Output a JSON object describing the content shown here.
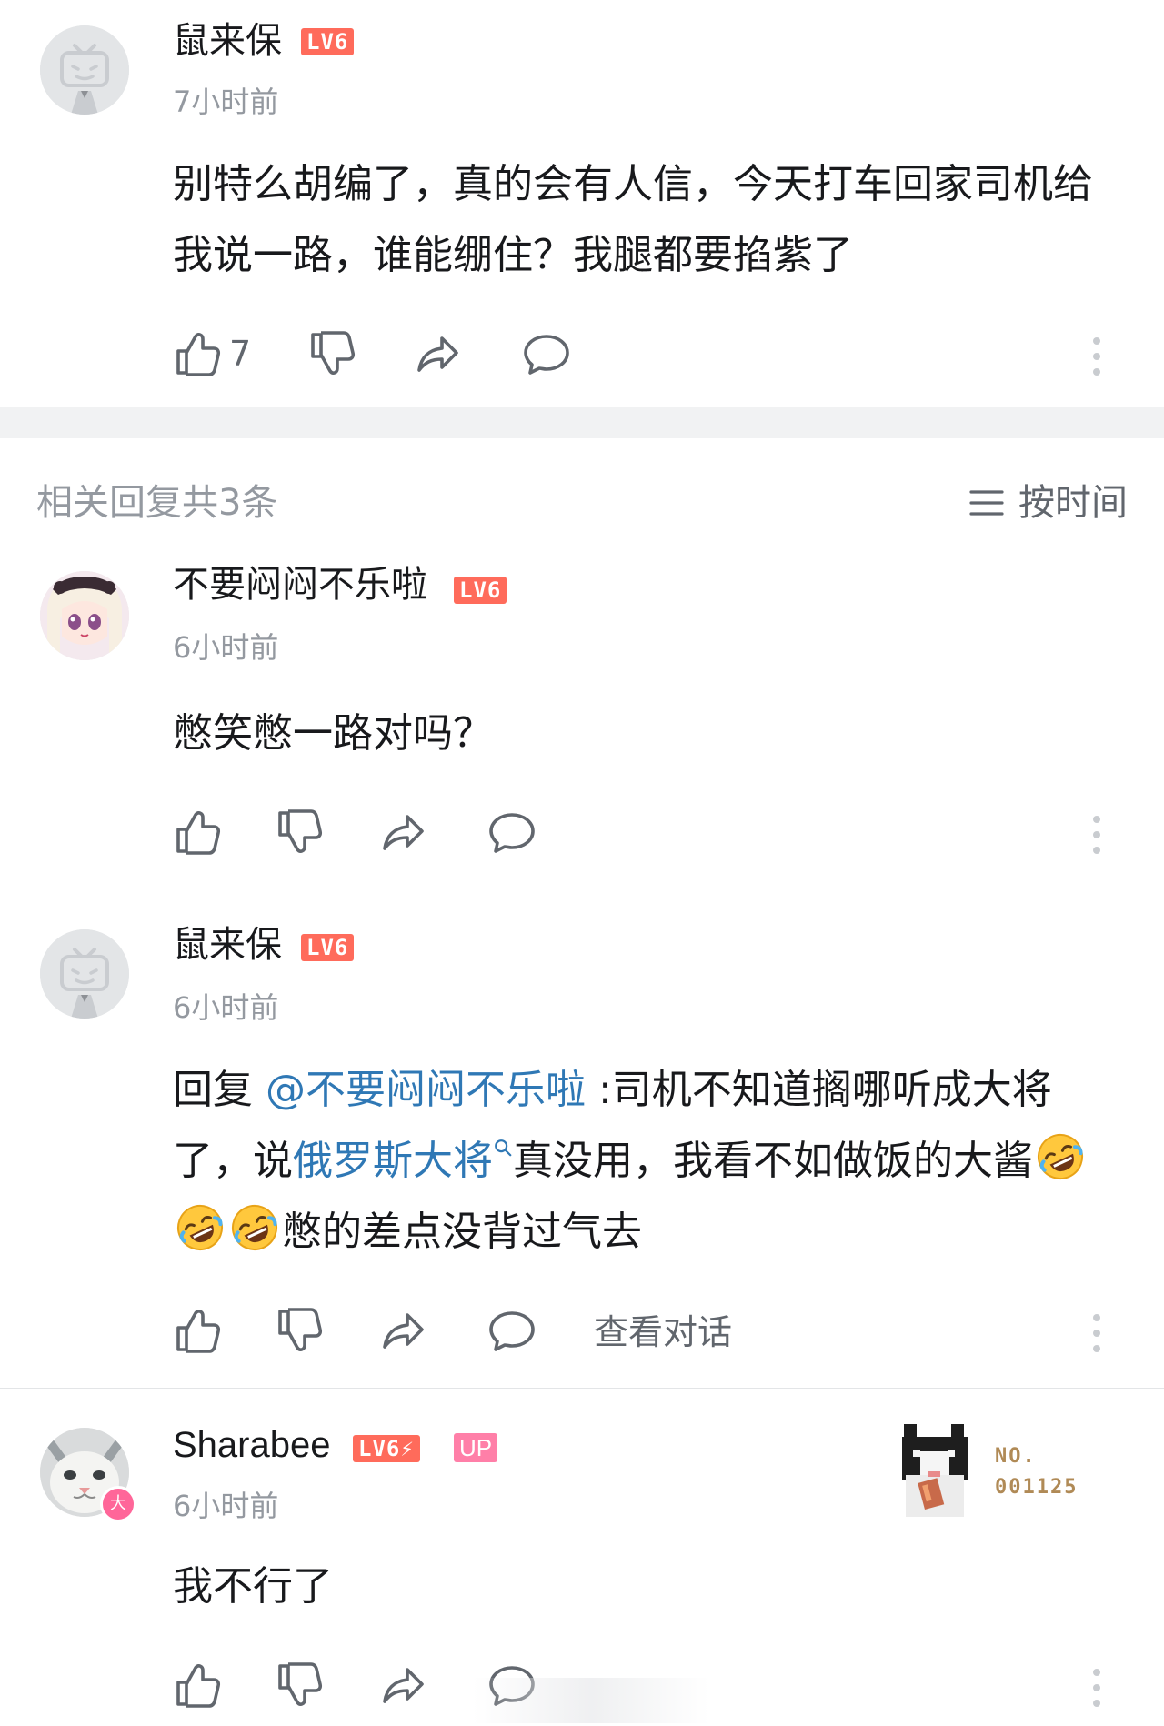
{
  "top_comment": {
    "username": "鼠来保",
    "level": "LV6",
    "time": "7小时前",
    "content": "别特么胡编了，真的会有人信，今天打车回家司机给我说一路，谁能绷住？我腿都要掐紫了",
    "like_count": "7"
  },
  "replies_header": {
    "count_label": "相关回复共3条",
    "sort_label": "按时间"
  },
  "replies": [
    {
      "username": "不要闷闷不乐啦",
      "level": "LV6",
      "time": "6小时前",
      "content": "憋笑憋一路对吗？"
    },
    {
      "username": "鼠来保",
      "level": "LV6",
      "time": "6小时前",
      "reply_prefix": "回复 ",
      "mention": "@不要闷闷不乐啦",
      "content_part1": " :司机不知道搁哪听成大将了，说",
      "link_text": "俄罗斯大将",
      "content_part2": "真没用，我看不如做饭的大酱",
      "content_part3": "憋的差点没背过气去",
      "emoji": "rofl-emoji",
      "view_conversation": "查看对话"
    },
    {
      "username": "Sharabee",
      "level": "LV6",
      "up_badge": "UP",
      "vip_badge": "大",
      "time": "6小时前",
      "content": "我不行了",
      "decor_no": "NO.",
      "decor_number": "001125"
    }
  ],
  "icons": {
    "like": "thumbs-up-icon",
    "dislike": "thumbs-down-icon",
    "share": "share-icon",
    "comment": "comment-icon",
    "more": "more-vertical-icon",
    "sort": "sort-lines-icon",
    "search": "search-icon"
  },
  "colors": {
    "level_badge": "#ff6b5b",
    "up_badge": "#ff7fa8",
    "link": "#2f78b5",
    "secondary_text": "#9499a0"
  }
}
